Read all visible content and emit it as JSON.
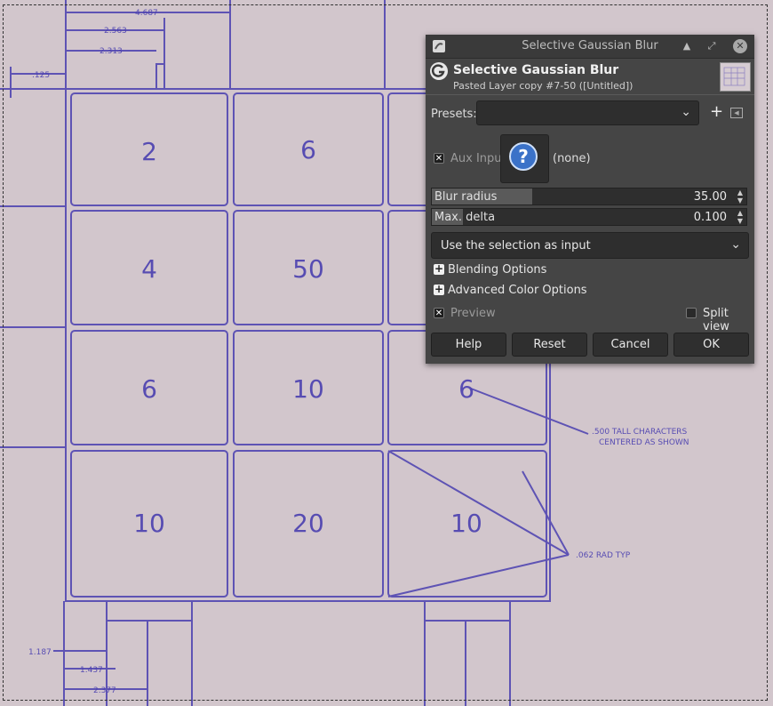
{
  "canvas": {
    "dimensions": [
      "4.687",
      "2.563",
      "2.313",
      ".125",
      "1.187",
      "1.437",
      "2.377"
    ],
    "cells": [
      "2",
      "6",
      "4",
      "50",
      "6",
      "10",
      "6",
      "10",
      "20",
      "10"
    ],
    "notes": [
      ".500 TALL CHARACTERS",
      "CENTERED AS SHOWN",
      ".062 RAD TYP"
    ]
  },
  "dialog": {
    "window_title": "Selective Gaussian Blur",
    "title": "Selective Gaussian Blur",
    "subtitle": "Pasted Layer copy #7-50 ([Untitled])",
    "presets_label": "Presets:",
    "presets_value": "",
    "aux_input_label": "Aux Input",
    "aux_input_value": "(none)",
    "blur_radius_label": "Blur radius",
    "blur_radius_value": "35.00",
    "blur_radius_fraction": 0.32,
    "max_delta_label": "Max. delta",
    "max_delta_value": "0.100",
    "max_delta_fraction": 0.1,
    "selection_mode": "Use the selection as input",
    "blending_options": "Blending Options",
    "advanced_color_options": "Advanced Color Options",
    "preview_label": "Preview",
    "split_view_label": "Split view",
    "help": "Help",
    "reset": "Reset",
    "cancel": "Cancel",
    "ok": "OK"
  }
}
